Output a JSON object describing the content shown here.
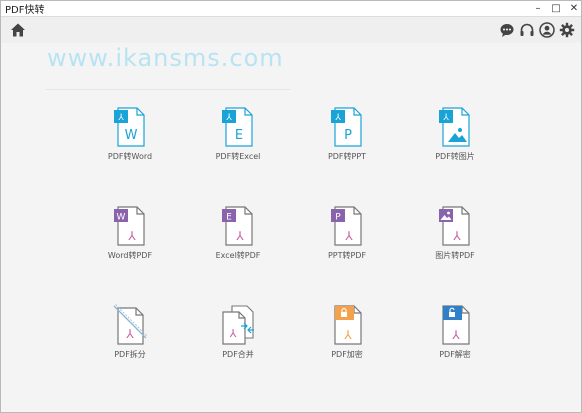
{
  "window": {
    "title": "PDF快转",
    "controls": {
      "minimize": "–",
      "maximize": "□",
      "close": "✕"
    }
  },
  "toolbar": {
    "icons": [
      "home-icon",
      "chat-icon",
      "headset-icon",
      "user-icon",
      "settings-icon"
    ]
  },
  "watermark": "www.ikansms.com",
  "tools": [
    {
      "label": "PDF转Word",
      "icon": "pdf-to-word-icon",
      "letter": "W"
    },
    {
      "label": "PDF转Excel",
      "icon": "pdf-to-excel-icon",
      "letter": "E"
    },
    {
      "label": "PDF转PPT",
      "icon": "pdf-to-ppt-icon",
      "letter": "P"
    },
    {
      "label": "PDF转图片",
      "icon": "pdf-to-image-icon",
      "letter": ""
    },
    {
      "label": "Word转PDF",
      "icon": "word-to-pdf-icon",
      "letter": "W"
    },
    {
      "label": "Excel转PDF",
      "icon": "excel-to-pdf-icon",
      "letter": "E"
    },
    {
      "label": "PPT转PDF",
      "icon": "ppt-to-pdf-icon",
      "letter": "P"
    },
    {
      "label": "图片转PDF",
      "icon": "image-to-pdf-icon",
      "letter": ""
    },
    {
      "label": "PDF拆分",
      "icon": "pdf-split-icon",
      "letter": ""
    },
    {
      "label": "PDF合并",
      "icon": "pdf-merge-icon",
      "letter": ""
    },
    {
      "label": "PDF加密",
      "icon": "pdf-encrypt-icon",
      "letter": ""
    },
    {
      "label": "PDF解密",
      "icon": "pdf-decrypt-icon",
      "letter": ""
    }
  ],
  "colors": {
    "blue_accent": "#1aa3d6",
    "purple_accent": "#8a63ad",
    "orange_accent": "#f3a14a",
    "decrypt_blue": "#2f7fc9",
    "pdf_mark": "#c65ea0"
  }
}
